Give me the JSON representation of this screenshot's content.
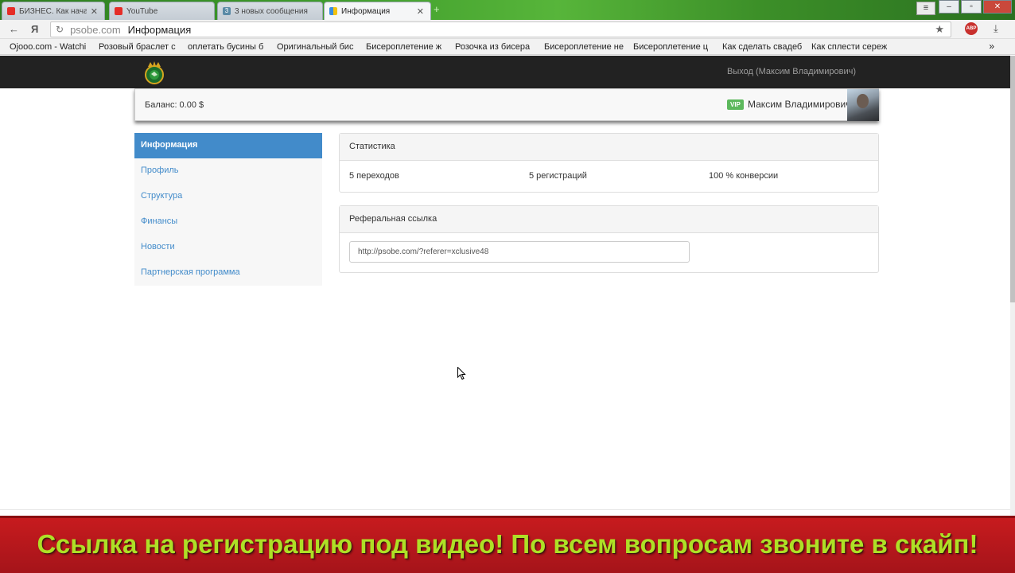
{
  "browser": {
    "tabs": [
      {
        "title": "БИЗНЕС. Как начать",
        "icon": "youtube-icon",
        "active": false
      },
      {
        "title": "YouTube",
        "icon": "youtube-icon",
        "active": false
      },
      {
        "title": "3 новых сообщения",
        "icon": "message-icon",
        "active": false
      },
      {
        "title": "Информация",
        "icon": "site-icon",
        "active": true
      }
    ],
    "url_domain": "psobe.com",
    "url_title": "Информация",
    "yandex_glyph": "Я",
    "abp_label": "ABP",
    "bookmarks": [
      "Ojooo.com - Watchi",
      "Розовый браслет с",
      "оплетать бусины б",
      "Оригинальный бис",
      "Бисероплетение ж",
      "Розочка из бисера",
      "Бисероплетение не",
      "Бисероплетение ц",
      "Как сделать свадеб",
      "Как сплести сереж"
    ],
    "bookmarks_more": "»"
  },
  "header": {
    "logout_label": "Выход (Максим Владимирович)"
  },
  "userbar": {
    "balance_label": "Баланс: 0.00 $",
    "vip_badge": "VIP",
    "username": "Максим Владимирович"
  },
  "sidebar": {
    "items": [
      {
        "label": "Информация",
        "active": true
      },
      {
        "label": "Профиль",
        "active": false
      },
      {
        "label": "Структура",
        "active": false
      },
      {
        "label": "Финансы",
        "active": false
      },
      {
        "label": "Новости",
        "active": false
      },
      {
        "label": "Партнерская программа",
        "active": false
      }
    ]
  },
  "stats_panel": {
    "title": "Статистика",
    "clicks": "5 переходов",
    "registrations": "5 регистраций",
    "conversion": "100 % конверсии"
  },
  "ref_panel": {
    "title": "Реферальная ссылка",
    "link": "http://psobe.com/?referer=xclusive48"
  },
  "banner": {
    "text": "Ссылка на регистрацию под видео! По всем вопросам звоните в скайп!"
  },
  "colors": {
    "primary": "#428bca",
    "vip": "#5cb85c",
    "banner_bg": "#c71b1e",
    "banner_text": "#aee026",
    "header_bg": "#222222"
  }
}
